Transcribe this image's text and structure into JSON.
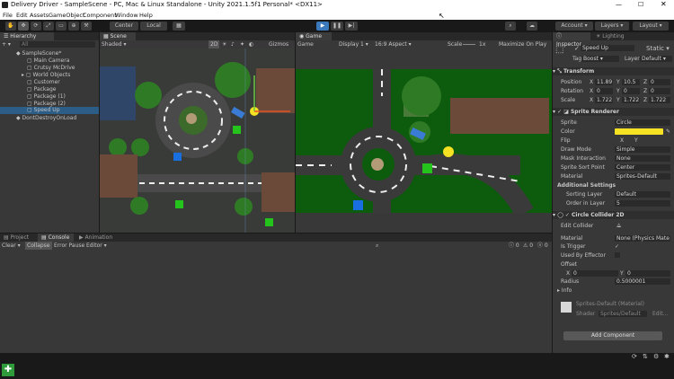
{
  "window": {
    "title": "Delivery Driver - SampleScene - PC, Mac & Linux Standalone - Unity 2021.1.5f1 Personal* <DX11>"
  },
  "menu": [
    "File",
    "Edit",
    "Assets",
    "GameObject",
    "Component",
    "Window",
    "Help"
  ],
  "toolbar": {
    "center": "Center",
    "local": "Local",
    "account": "Account",
    "layers": "Layers",
    "layout": "Layout"
  },
  "hierarchy": {
    "tab": "Hierarchy",
    "search_placeholder": "All",
    "items": [
      "SampleScene*",
      "Main Camera",
      "Crutsy McDrive",
      "World Objects",
      "Customer",
      "Package",
      "Package (1)",
      "Package (2)",
      "Speed Up",
      "DontDestroyOnLoad"
    ]
  },
  "scene": {
    "tab": "Scene",
    "shading": "Shaded",
    "mode": "2D",
    "gizmos": "Gizmos"
  },
  "game": {
    "tab": "Game",
    "view": "Game",
    "display": "Display 1",
    "aspect": "16:9 Aspect",
    "scale_label": "Scale",
    "scale_value": "1x",
    "maximize": "Maximize On Play"
  },
  "bottom": {
    "tabs": [
      "Project",
      "Console",
      "Animation"
    ],
    "clear": "Clear",
    "collapse": "Collapse",
    "error_pause": "Error Pause",
    "editor": "Editor",
    "counts": [
      "0",
      "0",
      "0"
    ]
  },
  "inspector": {
    "tabs": [
      "Inspector",
      "Lighting"
    ],
    "object_name": "Speed Up",
    "static": "Static",
    "tag_label": "Tag",
    "tag": "Boost",
    "layer_label": "Layer",
    "layer": "Default",
    "transform": {
      "title": "Transform",
      "position_label": "Position",
      "rotation_label": "Rotation",
      "scale_label": "Scale",
      "axis_x": "X",
      "axis_y": "Y",
      "axis_z": "Z",
      "position": [
        "11.89",
        "10.5",
        "0"
      ],
      "rotation": [
        "0",
        "0",
        "0"
      ],
      "scale": [
        "1.722",
        "1.722",
        "1.722"
      ]
    },
    "sprite_renderer": {
      "title": "Sprite Renderer",
      "sprite_label": "Sprite",
      "sprite": "Circle",
      "color_label": "Color",
      "color": "#f6e122",
      "flip_label": "Flip",
      "flip_x": "X",
      "flip_y": "Y",
      "draw_mode_label": "Draw Mode",
      "draw_mode": "Simple",
      "mask_label": "Mask Interaction",
      "mask": "None",
      "sort_point_label": "Sprite Sort Point",
      "sort_point": "Center",
      "material_label": "Material",
      "material": "Sprites-Default",
      "additional": "Additional Settings",
      "sorting_layer_label": "Sorting Layer",
      "sorting_layer": "Default",
      "order_label": "Order in Layer",
      "order": "5"
    },
    "circle_collider": {
      "title": "Circle Collider 2D",
      "edit_label": "Edit Collider",
      "material_label": "Material",
      "material": "None (Physics Mate",
      "trigger_label": "Is Trigger",
      "effector_label": "Used By Effector",
      "offset_label": "Offset",
      "offset_x": "0",
      "offset_y": "0",
      "radius_label": "Radius",
      "radius": "0.5000001",
      "info": "Info"
    },
    "material_block": {
      "name": "Sprites-Default (Material)",
      "shader_label": "Shader",
      "shader": "Sprites/Default",
      "edit": "Edit..."
    },
    "add_component": "Add Component"
  },
  "colors": {
    "grass": "#0d5c0d",
    "road": "#3a3a3a",
    "accent_yellow": "#f6e122",
    "package_green": "#25c41d",
    "customer_blue": "#1a6fe0"
  }
}
